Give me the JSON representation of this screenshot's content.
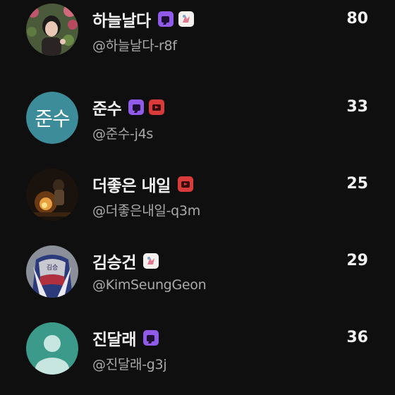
{
  "users": [
    {
      "name": "하늘날다",
      "handle": "@하늘날다-r8f",
      "count": "80",
      "avatar": "photo-girl-flowers",
      "badges": [
        "chat-icon",
        "sticker-icon"
      ]
    },
    {
      "name": "준수",
      "handle": "@준수-j4s",
      "count": "33",
      "avatar_text": "준수",
      "badges": [
        "chat-icon",
        "video-icon"
      ]
    },
    {
      "name": "더좋은 내일",
      "handle": "@더좋은내일-q3m",
      "count": "25",
      "avatar": "photo-campfire",
      "badges": [
        "video-icon"
      ]
    },
    {
      "name": "김승건",
      "handle": "@KimSeungGeon",
      "count": "29",
      "avatar": "photo-jersey",
      "badges": [
        "sticker-icon"
      ]
    },
    {
      "name": "진달래",
      "handle": "@진달래-g3j",
      "count": "36",
      "avatar": "default-person",
      "badges": [
        "chat-icon"
      ]
    }
  ],
  "colors": {
    "background": "#0f0f0f",
    "chat_badge": "#8f5be8",
    "video_badge": "#d93a3a",
    "default_avatar": "#3c9a8a",
    "text_avatar": "#3c8d99"
  }
}
